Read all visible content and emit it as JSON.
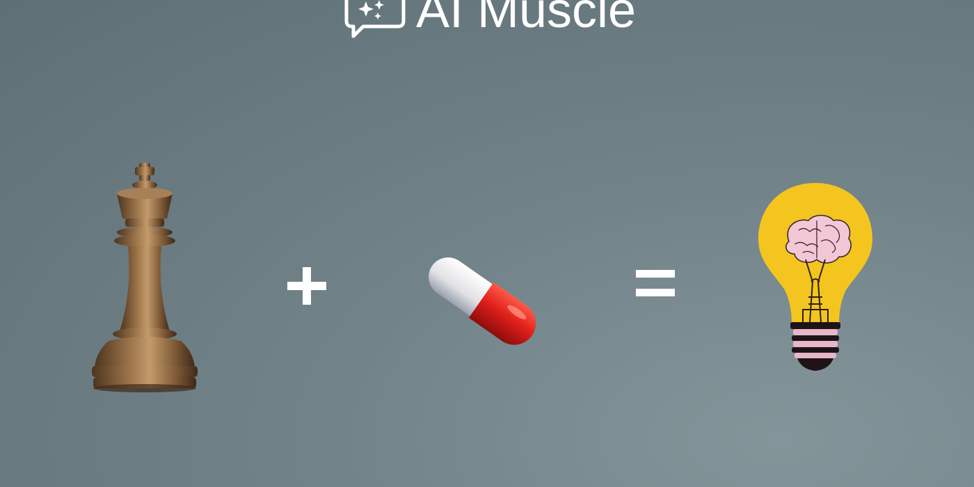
{
  "brand": {
    "name": "AI Muscle",
    "logo_icon": "chat-sparkles-icon"
  },
  "equation": {
    "items": [
      {
        "icon": "chess-king-icon"
      },
      {
        "operator": "plus-icon"
      },
      {
        "icon": "pill-capsule-icon"
      },
      {
        "operator": "equals-icon"
      },
      {
        "icon": "lightbulb-brain-icon"
      }
    ]
  },
  "colors": {
    "background": "#6f8086",
    "text": "#ffffff",
    "pill_red": "#e0201b",
    "pill_white": "#eeeeee",
    "bulb_yellow": "#f4c51f",
    "brain_pink": "#f2c7d6",
    "wood": "#8a6440"
  }
}
